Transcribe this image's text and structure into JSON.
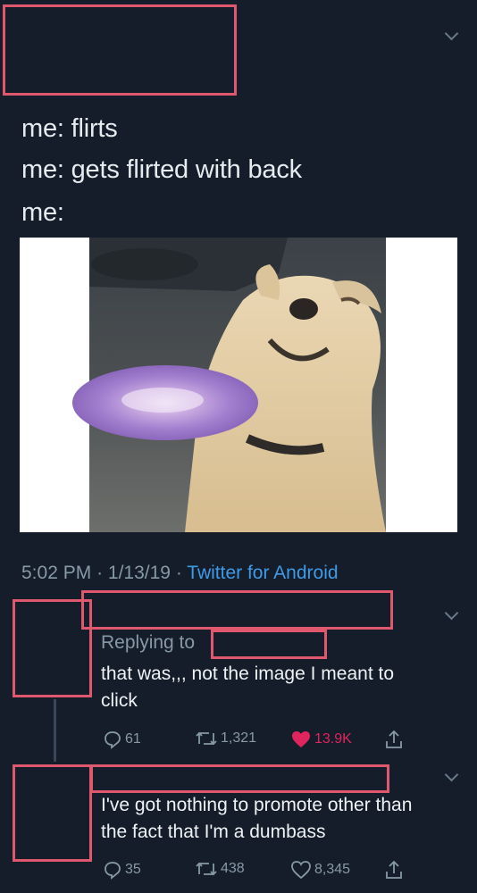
{
  "tweet": {
    "lines": [
      "me: flirts",
      "me: gets flirted with back",
      "me:"
    ],
    "time": "5:02 PM",
    "sep1": "·",
    "date": "1/13/19",
    "sep2": "·",
    "source": "Twitter for Android"
  },
  "replies": [
    {
      "replying_label": "Replying to",
      "text_lines": [
        "that was,,, not the image I meant to",
        "click"
      ],
      "comments": "61",
      "retweets": "1,321",
      "likes": "13.9K",
      "liked": true
    },
    {
      "text_lines": [
        "I've got nothing to promote other than",
        "the fact that I'm a dumbass"
      ],
      "comments": "35",
      "retweets": "438",
      "likes": "8,345",
      "liked": false
    }
  ],
  "colors": {
    "background": "#141d29",
    "redaction": "#e0586d",
    "link": "#3f9ae8",
    "like": "#e0245e",
    "muted": "#8899a6"
  }
}
